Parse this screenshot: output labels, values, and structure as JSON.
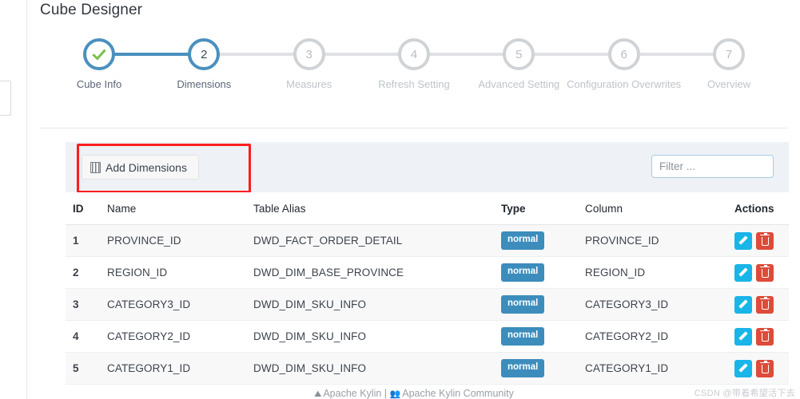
{
  "page": {
    "title": "Cube Designer",
    "watermark": "CSDN @带着希望活下去"
  },
  "stepper": {
    "steps": [
      {
        "num": "1",
        "label": "Cube Info",
        "state": "done",
        "icon": "check-icon"
      },
      {
        "num": "2",
        "label": "Dimensions",
        "state": "active"
      },
      {
        "num": "3",
        "label": "Measures",
        "state": "pending"
      },
      {
        "num": "4",
        "label": "Refresh Setting",
        "state": "pending"
      },
      {
        "num": "5",
        "label": "Advanced Setting",
        "state": "pending"
      },
      {
        "num": "6",
        "label": "Configuration Overwrites",
        "state": "pending"
      },
      {
        "num": "7",
        "label": "Overview",
        "state": "pending"
      }
    ]
  },
  "toolbar": {
    "add_dimensions_label": "Add Dimensions",
    "add_dimensions_icon": "building-grid-icon",
    "filter_value": "",
    "filter_placeholder": "Filter ...",
    "filter_icon": "search-icon",
    "highlight_color": "#fa1e1e",
    "band_background": "#eef1f6"
  },
  "table": {
    "columns": [
      "ID",
      "Name",
      "Table Alias",
      "Type",
      "Column",
      "Actions"
    ],
    "badge_color": "#3c8dbc",
    "edit_color": "#19b5e8",
    "delete_color": "#dd4b39",
    "rows": [
      {
        "id": "1",
        "name": "PROVINCE_ID",
        "alias": "DWD_FACT_ORDER_DETAIL",
        "type": "normal",
        "column": "PROVINCE_ID"
      },
      {
        "id": "2",
        "name": "REGION_ID",
        "alias": "DWD_DIM_BASE_PROVINCE",
        "type": "normal",
        "column": "REGION_ID"
      },
      {
        "id": "3",
        "name": "CATEGORY3_ID",
        "alias": "DWD_DIM_SKU_INFO",
        "type": "normal",
        "column": "CATEGORY3_ID"
      },
      {
        "id": "4",
        "name": "CATEGORY2_ID",
        "alias": "DWD_DIM_SKU_INFO",
        "type": "normal",
        "column": "CATEGORY2_ID"
      },
      {
        "id": "5",
        "name": "CATEGORY1_ID",
        "alias": "DWD_DIM_SKU_INFO",
        "type": "normal",
        "column": "CATEGORY1_ID"
      }
    ],
    "edit_icon": "pencil-icon",
    "delete_icon": "trash-icon"
  },
  "footer": {
    "link1": "Apache Kylin",
    "separator": "|",
    "link2": "Apache Kylin Community",
    "icon1": "kylin-logo-icon",
    "icon2": "community-people-icon"
  }
}
